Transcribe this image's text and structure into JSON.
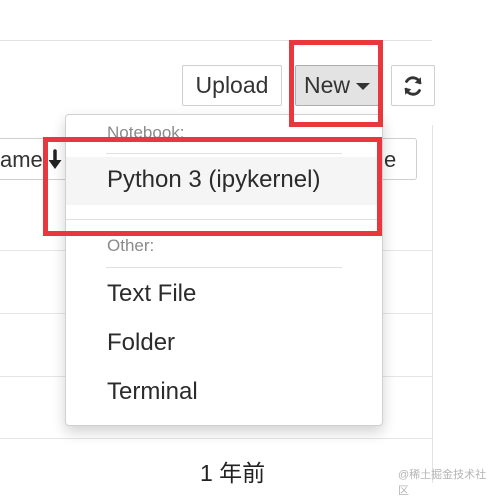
{
  "toolbar": {
    "upload_label": "Upload",
    "new_label": "New",
    "refresh_icon": "refresh-icon"
  },
  "table": {
    "name_header_partial": "ame",
    "sort_icon": "arrow-down-icon",
    "size_header_partial": "ze",
    "row_modified": "1 年前"
  },
  "new_menu": {
    "notebook_header": "Notebook:",
    "python_kernel": "Python 3 (ipykernel)",
    "other_header": "Other:",
    "items": [
      "Text File",
      "Folder",
      "Terminal"
    ]
  },
  "annotations": {
    "highlight_color": "#e8383e"
  },
  "watermark": "@稀土掘金技术社区"
}
